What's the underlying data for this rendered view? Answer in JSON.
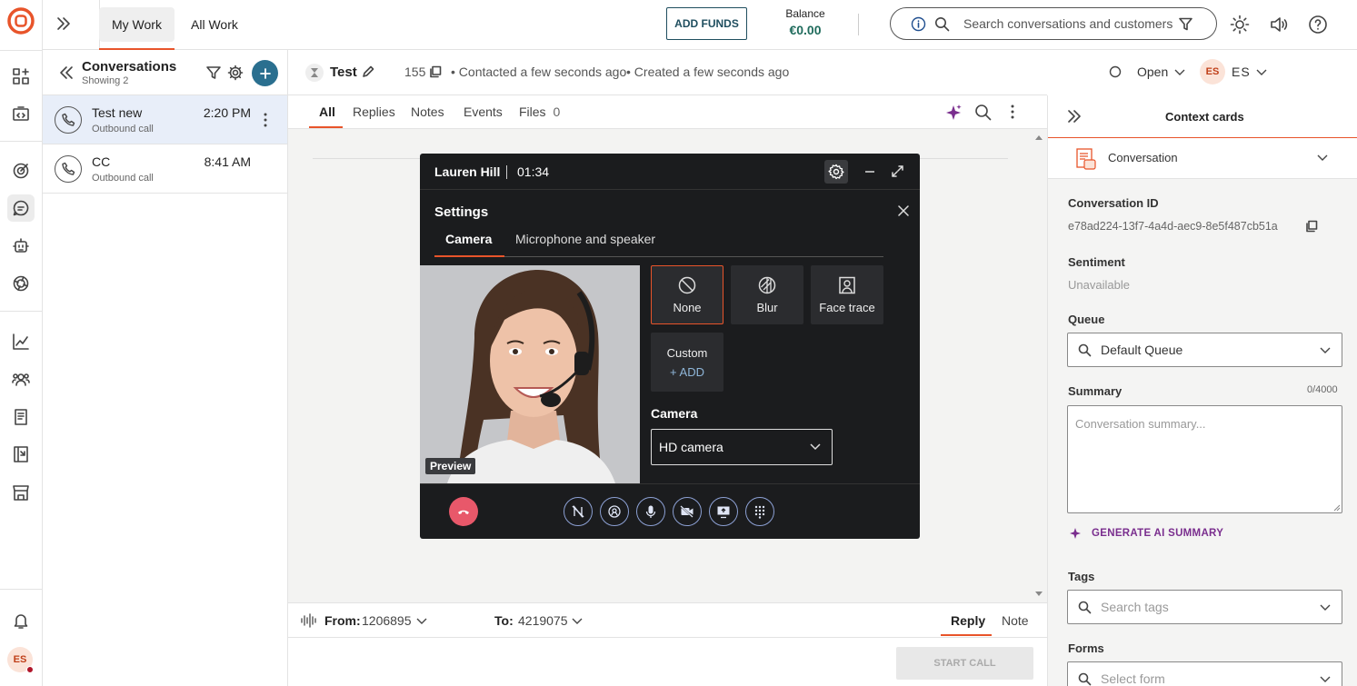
{
  "topbar": {
    "tabs": [
      "My Work",
      "All Work"
    ],
    "add_funds": "ADD FUNDS",
    "balance_label": "Balance",
    "balance_value": "€0.00",
    "search_placeholder": "Search conversations and customers"
  },
  "conversations": {
    "title": "Conversations",
    "subtitle": "Showing 2",
    "items": [
      {
        "name": "Test new",
        "sub": "Outbound call",
        "time": "2:20 PM"
      },
      {
        "name": "CC",
        "sub": "Outbound call",
        "time": "8:41 AM"
      }
    ]
  },
  "main": {
    "title": "Test",
    "id": "155",
    "contacted": "• Contacted a few seconds ago",
    "created": "• Created a few seconds ago",
    "status": "Open",
    "agent_initials": "ES",
    "agent_name": "ES",
    "tabs": [
      "All",
      "Replies",
      "Notes",
      "Events",
      "Files"
    ],
    "files_count": "0",
    "from_label": "From:",
    "from_value": "1206895",
    "to_label": "To:",
    "to_value": "4219075",
    "reply": "Reply",
    "note": "Note",
    "start_call": "START CALL"
  },
  "call": {
    "caller": "Lauren Hill",
    "timer": "01:34",
    "settings_title": "Settings",
    "tabs": [
      "Camera",
      "Microphone and speaker"
    ],
    "bg_options": [
      "None",
      "Blur",
      "Face trace"
    ],
    "custom_label": "Custom",
    "custom_add": "+ ADD",
    "camera_label": "Camera",
    "camera_value": "HD camera",
    "preview_label": "Preview"
  },
  "context": {
    "title": "Context cards",
    "section": "Conversation",
    "conv_id_label": "Conversation ID",
    "conv_id": "e78ad224-13f7-4a4d-aec9-8e5f487cb51a",
    "sentiment_label": "Sentiment",
    "sentiment_value": "Unavailable",
    "queue_label": "Queue",
    "queue_value": "Default Queue",
    "summary_label": "Summary",
    "summary_count": "0/4000",
    "summary_placeholder": "Conversation summary...",
    "generate": "GENERATE AI SUMMARY",
    "tags_label": "Tags",
    "tags_placeholder": "Search tags",
    "forms_label": "Forms",
    "forms_placeholder": "Select form"
  },
  "user_initials": "ES",
  "colors": {
    "accent": "#e8542a",
    "teal": "#2a6f8f",
    "balance": "#1f6b5c",
    "purple": "#7a2e8e",
    "hangup": "#e8586a"
  }
}
